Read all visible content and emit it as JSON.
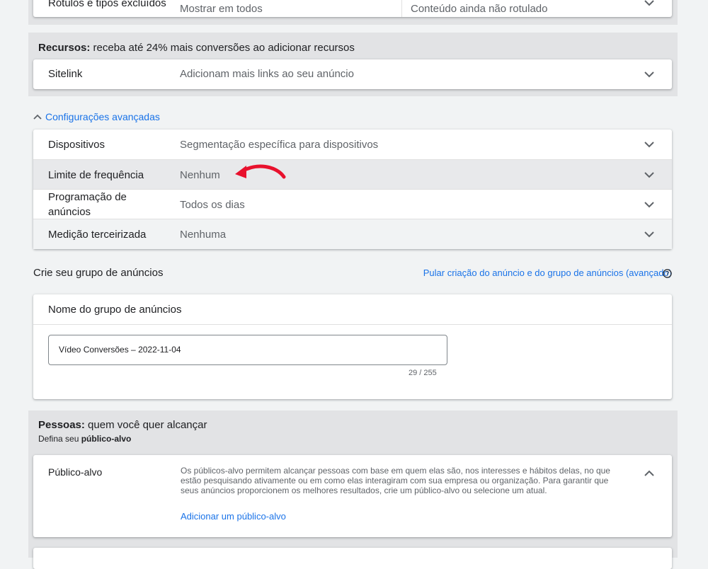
{
  "top_row": {
    "label": "Rótulos e tipos excluídos",
    "value1": "Mostrar em todos",
    "value2": "Conteúdo ainda não rotulado"
  },
  "resources": {
    "title_bold": "Recursos:",
    "title_rest": " receba até 24% mais conversões ao adicionar recursos",
    "sitelink_label": "Sitelink",
    "sitelink_value": "Adicionam mais links ao seu anúncio"
  },
  "advanced": {
    "toggle_label": "Configurações avançadas",
    "rows": [
      {
        "label": "Dispositivos",
        "value": "Segmentação específica para dispositivos"
      },
      {
        "label": "Limite de frequência",
        "value": "Nenhum"
      },
      {
        "label": "Programação de anúncios",
        "value": "Todos os dias"
      },
      {
        "label": "Medição terceirizada",
        "value": "Nenhuma"
      }
    ]
  },
  "ad_group": {
    "heading": "Crie seu grupo de anúncios",
    "skip_link": "Pular criação do anúncio e do grupo de anúncios (avançado)",
    "card_title": "Nome do grupo de anúncios",
    "name_value": "Vídeo Conversões – 2022-11-04",
    "char_count": "29 / 255"
  },
  "people": {
    "title_bold": "Pessoas:",
    "title_rest": " quem você quer alcançar",
    "subtitle_pre": "Defina seu ",
    "subtitle_bold": "público-alvo",
    "audience_label": "Público-alvo",
    "audience_desc": "Os públicos-alvo permitem alcançar pessoas com base em quem elas são, nos interesses e hábitos delas, no que estão pesquisando ativamente ou em como elas interagiram com sua empresa ou organização. Para garantir que seus anúncios proporcionem os melhores resultados, crie um público-alvo ou selecione um atual.",
    "add_audience_link": "Adicionar um público-alvo"
  },
  "colors": {
    "accent": "#1a73e8",
    "annotation_arrow": "#e8112d"
  }
}
